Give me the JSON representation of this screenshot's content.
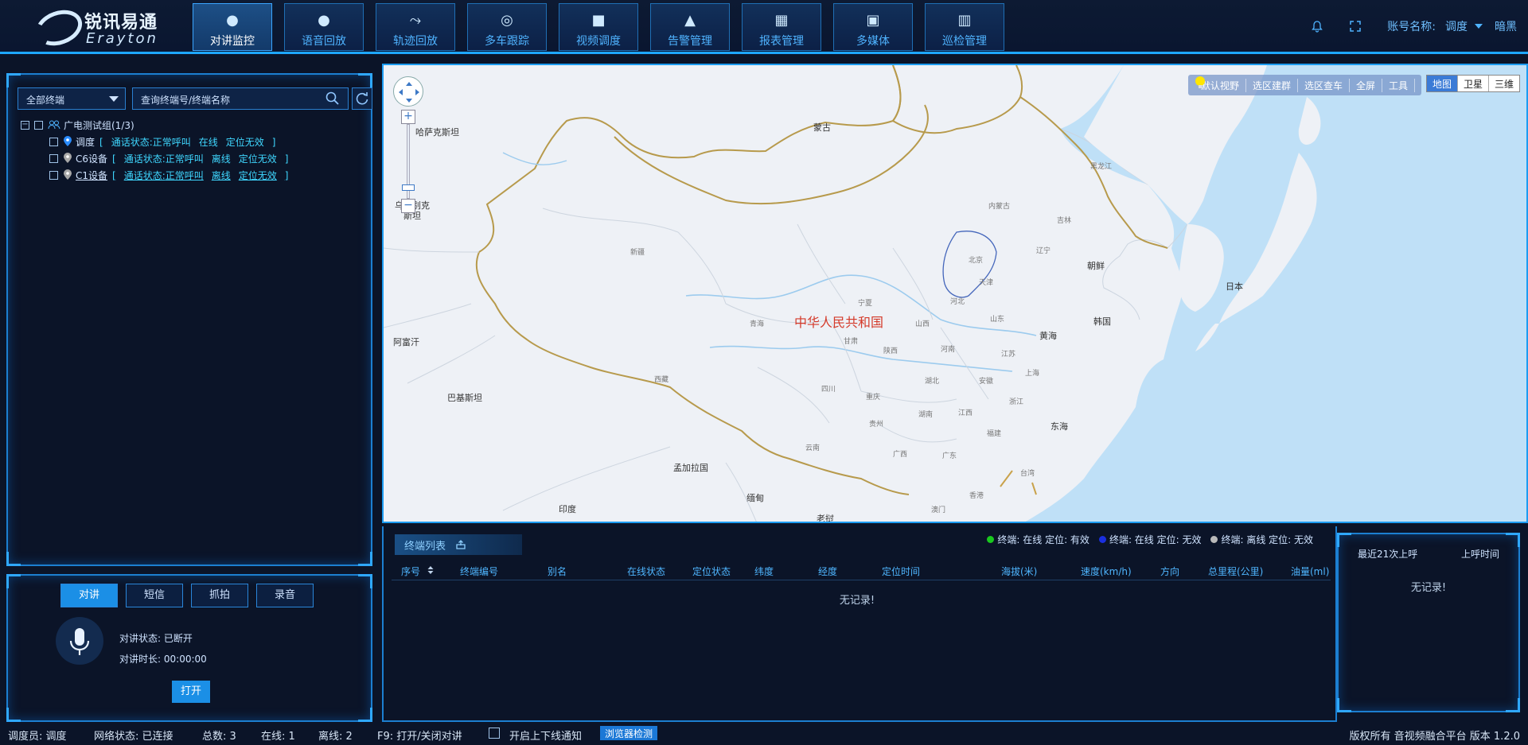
{
  "brand": {
    "cn": "锐讯易通",
    "en": "Erayton"
  },
  "nav": [
    {
      "label": "对讲监控",
      "icon": "location-pin-icon"
    },
    {
      "label": "语音回放",
      "icon": "microphone-icon"
    },
    {
      "label": "轨迹回放",
      "icon": "route-icon"
    },
    {
      "label": "多车跟踪",
      "icon": "target-icon"
    },
    {
      "label": "视频调度",
      "icon": "video-camera-icon"
    },
    {
      "label": "告警管理",
      "icon": "alarm-bell-icon"
    },
    {
      "label": "报表管理",
      "icon": "chart-report-icon"
    },
    {
      "label": "多媒体",
      "icon": "media-icon"
    },
    {
      "label": "巡检管理",
      "icon": "building-icon"
    }
  ],
  "header": {
    "account_label": "账号名称:",
    "account_name": "调度",
    "theme": "暗黑"
  },
  "tree": {
    "filter": "全部终端",
    "search_placeholder": "查询终端号/终端名称",
    "group": "广电测试组(1/3)",
    "devices": [
      {
        "name": "调度",
        "status_label": "通话状态:",
        "call": "正常呼叫",
        "online": "在线",
        "loc": "定位无效"
      },
      {
        "name": "C6设备",
        "status_label": "通话状态:",
        "call": "正常呼叫",
        "online": "离线",
        "loc": "定位无效"
      },
      {
        "name": "C1设备",
        "status_label": "通话状态:",
        "call": "正常呼叫",
        "online": "离线",
        "loc": "定位无效"
      }
    ],
    "bracket_open": "[",
    "bracket_close": "]"
  },
  "controls": {
    "tabs": [
      "对讲",
      "短信",
      "抓拍",
      "录音"
    ],
    "talk_status_label": "对讲状态:",
    "talk_status": "已断开",
    "talk_duration_label": "对讲时长:",
    "talk_duration": "00:00:00",
    "open_button": "打开"
  },
  "map": {
    "toolbar": [
      "默认视野",
      "选区建群",
      "选区查车",
      "全屏",
      "工具"
    ],
    "types": [
      "地图",
      "卫星",
      "三维"
    ],
    "labels": {
      "kazakhstan": "哈萨克斯坦",
      "mongolia": "蒙古",
      "uzbekistan": "乌兹别克\n斯坦",
      "afghanistan": "阿富汗",
      "pakistan": "巴基斯坦",
      "india": "印度",
      "bangladesh": "孟加拉国",
      "myanmar": "缅甸",
      "laos": "老挝",
      "china": "中华人民共和国",
      "north_korea": "朝鲜",
      "south_korea": "韩国",
      "japan": "日本",
      "yellow_sea": "黄海",
      "east_sea": "东海"
    },
    "provinces": [
      "新疆",
      "西藏",
      "青海",
      "甘肃",
      "四川",
      "云南",
      "内蒙古",
      "黑龙江",
      "吉林",
      "辽宁",
      "北京",
      "天津",
      "河北",
      "山西",
      "山东",
      "河南",
      "陕西",
      "宁夏",
      "湖北",
      "湖南",
      "贵州",
      "重庆",
      "广西",
      "广东",
      "江西",
      "福建",
      "浙江",
      "安徽",
      "江苏",
      "台湾",
      "香港",
      "澳门",
      "上海"
    ]
  },
  "terminals": {
    "tab": "终端列表",
    "legend": [
      {
        "color": "#19c81e",
        "text": "终端: 在线 定位: 有效"
      },
      {
        "color": "#1a2fe0",
        "text": "终端: 在线 定位: 无效"
      },
      {
        "color": "#b9b9b9",
        "text": "终端: 离线 定位: 无效"
      }
    ],
    "columns": [
      "序号",
      "终端编号",
      "别名",
      "在线状态",
      "定位状态",
      "纬度",
      "经度",
      "定位时间",
      "海拔(米)",
      "速度(km/h)",
      "方向",
      "总里程(公里)",
      "油量(ml)"
    ],
    "empty": "无记录!"
  },
  "calls": {
    "col1": "最近21次上呼",
    "col2": "上呼时间",
    "empty": "无记录!"
  },
  "footer": {
    "dispatcher": "调度员: 调度",
    "network": "网络状态: 已连接",
    "total": "总数: 3",
    "online": "在线: 1",
    "offline": "离线: 2",
    "hotkey": "F9: 打开/关闭对讲",
    "notify": "开启上下线通知",
    "browser": "浏览器检测",
    "copyright": "版权所有 音视频融合平台 版本 1.2.0"
  },
  "colors": {
    "accent": "#1ea7ff",
    "panel_bg": "#0b1428",
    "online_green": "#19c81e",
    "map_red": "#d43a2a"
  }
}
